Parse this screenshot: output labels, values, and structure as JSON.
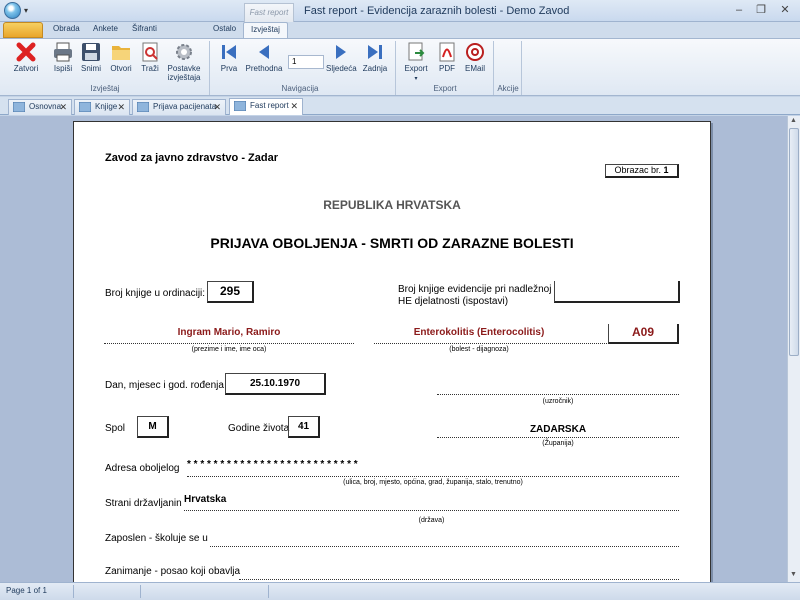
{
  "window": {
    "title": "Fast report - Evidencija zaraznih bolesti - Demo Zavod",
    "context_tab": "Fast report",
    "controls": {
      "minimize": "–",
      "restore": "❐",
      "close": "✕"
    }
  },
  "ribbon_tabs": [
    "Obrada",
    "Ankete",
    "Šifranti",
    "Ostalo",
    "Izvještaj"
  ],
  "ribbon": {
    "groups": {
      "izvjestaj": {
        "label": "Izvještaj",
        "buttons": [
          "Zatvori",
          "Ispiši",
          "Snimi",
          "Otvori",
          "Traži"
        ],
        "settings_line1": "Postavke",
        "settings_line2": "izvještaja"
      },
      "navigacija": {
        "label": "Navigacija",
        "first": "Prva",
        "prev": "Prethodna",
        "page_value": "1",
        "next": "Sljedeća",
        "last": "Zadnja"
      },
      "export": {
        "label": "Export",
        "buttons": [
          "Export",
          "PDF",
          "EMail"
        ]
      },
      "akcije": {
        "label": "Akcije"
      }
    }
  },
  "doc_tabs": [
    "Osnovna",
    "Knjige",
    "Prijava pacijenata",
    "Fast report"
  ],
  "report": {
    "institution": "Zavod za javno zdravstvo - Zadar",
    "form_label": "Obrazac br.",
    "form_number": "1",
    "country": "REPUBLIKA HRVATSKA",
    "title": "PRIJAVA OBOLJENJA - SMRTI OD ZARAZNE BOLESTI",
    "book_no_label": "Broj knjige u ordinaciji:",
    "book_no": "295",
    "evidence_label_1": "Broj knjige evidencije pri nadležnoj",
    "evidence_label_2": "HE djelatnosti (ispostavi)",
    "evidence_no": "",
    "patient_name": "Ingram Mario, Ramiro",
    "patient_caption": "(prezime i ime, ime oca)",
    "disease": "Enterokolitis (Enterocolitis)",
    "disease_caption": "(bolest - dijagnoza)",
    "diagnosis_code": "A09",
    "dob_label": "Dan, mjesec i god. rođenja",
    "dob": "25.10.1970",
    "cause_caption": "(uzročnik)",
    "sex_label": "Spol",
    "sex": "M",
    "age_label": "Godine života",
    "age": "41",
    "county": "ZADARSKA",
    "county_caption": "(Županija)",
    "address_label": "Adresa oboljelog",
    "address": "* * * * * * * * * * * * * * * * * * * * *   * * * * *",
    "address_caption": "(ulica, broj, mjesto, općina, grad, županija, stalo, trenutno)",
    "foreigner_label": "Strani državljanin",
    "foreigner": "Hrvatska",
    "country_caption": "(država)",
    "employed_label": "Zaposlen - školuje se u",
    "occupation_label": "Zanimanje - posao koji obavlja"
  },
  "status": {
    "page": "Page 1 of 1"
  }
}
